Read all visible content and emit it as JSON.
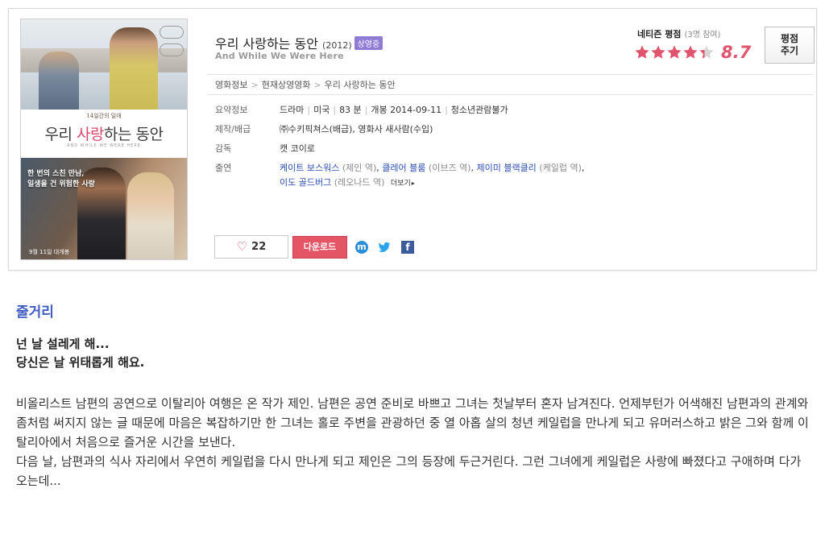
{
  "movie": {
    "title_kr": "우리 사랑하는 동안",
    "year": "(2012)",
    "status_badge": "상영중",
    "title_en": "And While We Were Here"
  },
  "poster": {
    "small_text": "14일간의 밀애",
    "title_part1": "우리 ",
    "title_pink": "사랑",
    "title_part2": "하는 동안",
    "subtitle": "AND WHILE WE WERE HERE",
    "tagline_line1": "한 번의 스친 만남,",
    "tagline_line2": "일생을 건 위험한 사랑",
    "date": "9월 11일 대개봉"
  },
  "rating": {
    "label": "네티즌 평점",
    "count": "(3명 참여)",
    "score": "8.7",
    "stars_value": 4.35,
    "stars_max": 5,
    "review_button": "평점\n주기"
  },
  "breadcrumb": [
    "영화정보",
    "현재상영영화",
    "우리 사랑하는 동안"
  ],
  "info": {
    "summary_label": "요약정보",
    "genre": "드라마",
    "country": "미국",
    "runtime": "83 분",
    "release": "개봉 2014-09-11",
    "rating_class": "청소년관람불가",
    "production_label": "제작/배급",
    "production": "㈜수키픽쳐스(배급), 영화사 새사람(수입)",
    "director_label": "감독",
    "director": "캣 코이로",
    "cast_label": "출연",
    "cast": [
      {
        "name": "케이트 보스워스",
        "role": "(제인 역)"
      },
      {
        "name": "클레어 블룸",
        "role": "(이브즈 역)"
      },
      {
        "name": "제이미 블랙클리",
        "role": "(케일럽 역)"
      },
      {
        "name": "이도 골드버그",
        "role": "(레오나드 역)"
      }
    ],
    "more": "더보기"
  },
  "actions": {
    "like_count": "22",
    "download": "다운로드",
    "me2day": "m",
    "facebook": "f"
  },
  "colors": {
    "accent_pink": "#e0546e",
    "link_blue": "#2a4db0",
    "badge_purple": "#8f7ad6",
    "download_red": "#e45665",
    "heading_blue": "#3d5cc4"
  },
  "synopsis": {
    "heading": "줄거리",
    "tagline_line1": "넌 날 설레게 해...",
    "tagline_line2": "당신은 날 위태롭게 해요.",
    "body": "비올리스트 남편의 공연으로 이탈리아 여행은 온 작가 제인. 남편은 공연 준비로 바쁘고 그녀는 첫날부터 혼자 남겨진다. 언제부턴가 어색해진 남편과의 관계와 좀처럼 써지지 않는 글 때문에 마음은 복잡하기만 한 그녀는 홀로 주변을 관광하던 중 열 아홉 살의 청년 케일럽을 만나게 되고 유머러스하고 밝은 그와 함께 이탈리아에서 처음으로 즐거운 시간을 보낸다.",
    "body2": "다음 날, 남편과의 식사 자리에서 우연히 케일럽을 다시 만나게 되고 제인은 그의 등장에 두근거린다. 그런 그녀에게 케일럽은 사랑에 빠졌다고 구애하며 다가오는데..."
  }
}
